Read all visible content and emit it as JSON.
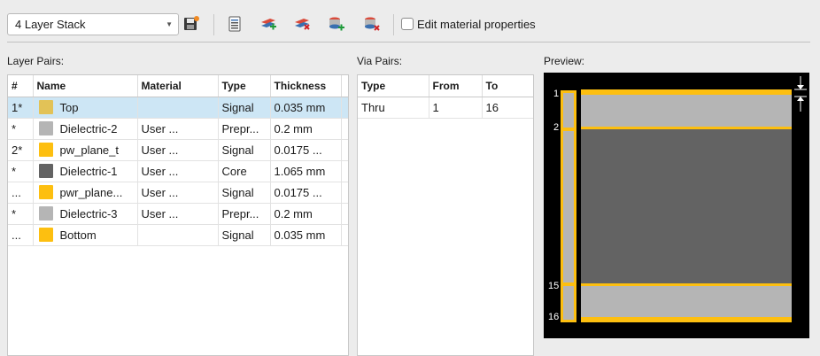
{
  "toolbar": {
    "stack_name": "4 Layer Stack",
    "edit_material_label": "Edit material properties",
    "edit_material_checked": false
  },
  "layer_pairs": {
    "label": "Layer Pairs:",
    "columns": [
      "#",
      "Name",
      "Material",
      "Type",
      "Thickness"
    ],
    "rows": [
      {
        "num": "1*",
        "name": "Top",
        "material": "",
        "type": "Signal",
        "thickness": "0.035 mm",
        "color": "#e2c257",
        "selected": true
      },
      {
        "num": "*",
        "name": "Dielectric-2",
        "material": "User ...",
        "type": "Prepr...",
        "thickness": "0.2 mm",
        "color": "#b5b5b5",
        "selected": false
      },
      {
        "num": "2*",
        "name": "pw_plane_t",
        "material": "User ...",
        "type": "Signal",
        "thickness": "0.0175 ...",
        "color": "#fdbf10",
        "selected": false
      },
      {
        "num": "*",
        "name": "Dielectric-1",
        "material": "User ...",
        "type": "Core",
        "thickness": "1.065 mm",
        "color": "#636363",
        "selected": false
      },
      {
        "num": "...",
        "name": "pwr_plane...",
        "material": "User ...",
        "type": "Signal",
        "thickness": "0.0175 ...",
        "color": "#fdbf10",
        "selected": false
      },
      {
        "num": "*",
        "name": "Dielectric-3",
        "material": "User ...",
        "type": "Prepr...",
        "thickness": "0.2 mm",
        "color": "#b5b5b5",
        "selected": false
      },
      {
        "num": "...",
        "name": "Bottom",
        "material": "",
        "type": "Signal",
        "thickness": "0.035 mm",
        "color": "#fdbf10",
        "selected": false
      }
    ]
  },
  "via_pairs": {
    "label": "Via Pairs:",
    "columns": [
      "Type",
      "From",
      "To"
    ],
    "rows": [
      {
        "type": "Thru",
        "from": "1",
        "to": "16"
      }
    ]
  },
  "preview": {
    "label": "Preview:",
    "layer_numbers": [
      "1",
      "2",
      "15",
      "16"
    ],
    "colors": {
      "copper": "#fdbf10",
      "prepreg": "#b5b5b5",
      "core": "#636363",
      "background": "#000000"
    }
  }
}
